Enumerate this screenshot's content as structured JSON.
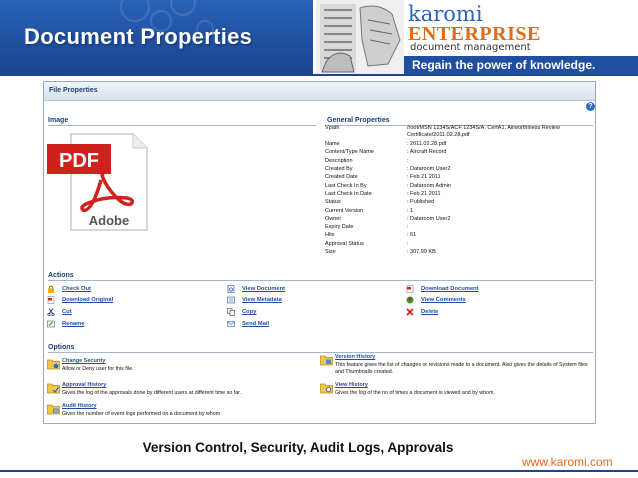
{
  "banner": {
    "title": "Document Properties",
    "brand_name": "karomi",
    "brand_product": "ENTERPRISE",
    "brand_sub": "document management",
    "brand_tagline": "Regain the power of knowledge."
  },
  "panel": {
    "title": "File Properties",
    "help_icon": "?"
  },
  "image_section": {
    "title": "Image",
    "icon": "pdf-adobe-icon",
    "icon_text_top": "PDF",
    "icon_text_bottom": "Adobe"
  },
  "general": {
    "title": "General Properties",
    "rows": [
      {
        "label": "Vpath",
        "value": "/root/MSN 1234S/ACF 1234S/A. CertA1. Airworthiness Review Certificate/2011.02.28.pdf"
      },
      {
        "label": "Name",
        "value": ": 2011.02.28.pdf"
      },
      {
        "label": "Content/Type Name",
        "value": ": Aircraft Record"
      },
      {
        "label": "Description",
        "value": ":"
      },
      {
        "label": "Created By",
        "value": ": Dataroom User2"
      },
      {
        "label": "Created Date",
        "value": ": Feb 21 2011"
      },
      {
        "label": "Last Check In By",
        "value": ": Dataroom Admin"
      },
      {
        "label": "Last Check In Date",
        "value": ": Feb 21 2011"
      },
      {
        "label": "Status",
        "value": ": Published"
      },
      {
        "label": "Current Version",
        "value": ": 1"
      },
      {
        "label": "Owner",
        "value": ": Dataroom User2"
      },
      {
        "label": "Expiry Date",
        "value": ":"
      },
      {
        "label": "Hits",
        "value": ": 61"
      },
      {
        "label": "Approval Status",
        "value": ":"
      },
      {
        "label": "Size",
        "value": ": 307.99 KB"
      }
    ]
  },
  "actions": {
    "title": "Actions",
    "items": [
      {
        "label": "Check Out",
        "icon": "lock-icon"
      },
      {
        "label": "View Document",
        "icon": "document-view-icon"
      },
      {
        "label": "Download Document",
        "icon": "pdf-download-icon"
      },
      {
        "label": "Download Original",
        "icon": "pdf-original-icon"
      },
      {
        "label": "View Metadata",
        "icon": "metadata-icon"
      },
      {
        "label": "View Comments",
        "icon": "comments-icon"
      },
      {
        "label": "Cut",
        "icon": "scissors-icon"
      },
      {
        "label": "Copy",
        "icon": "copy-icon"
      },
      {
        "label": "Delete",
        "icon": "delete-x-icon"
      },
      {
        "label": "Rename",
        "icon": "rename-icon"
      },
      {
        "label": "Send Mail",
        "icon": "mail-icon"
      }
    ]
  },
  "options": {
    "title": "Options",
    "items": [
      {
        "label": "Change Security",
        "desc": "Allow or Deny user for this file.",
        "icon": "security-folder-icon"
      },
      {
        "label": "Version History",
        "desc": "This feature gives the list of changes or revisions made to a document. Also gives the details of System files and Thumbnails created.",
        "icon": "version-folder-icon"
      },
      {
        "label": "Approval History",
        "desc": "Gives the log of the approvals done by different users at different time so far.",
        "icon": "approval-folder-icon"
      },
      {
        "label": "View History",
        "desc": "Gives the log of the no of times a document is viewed and by whom.",
        "icon": "view-history-folder-icon"
      },
      {
        "label": "Audit History",
        "desc": "Gives the number of event logs performed on a document by whom.",
        "icon": "audit-folder-icon"
      }
    ]
  },
  "caption": "Version Control, Security, Audit Logs, Approvals",
  "footer_url": "www.karomi.com",
  "colors": {
    "banner_blue": "#1f4f9e",
    "brand_orange": "#e06a1a",
    "link_blue": "#1d4f9e",
    "heading_blue": "#1d3f73"
  }
}
